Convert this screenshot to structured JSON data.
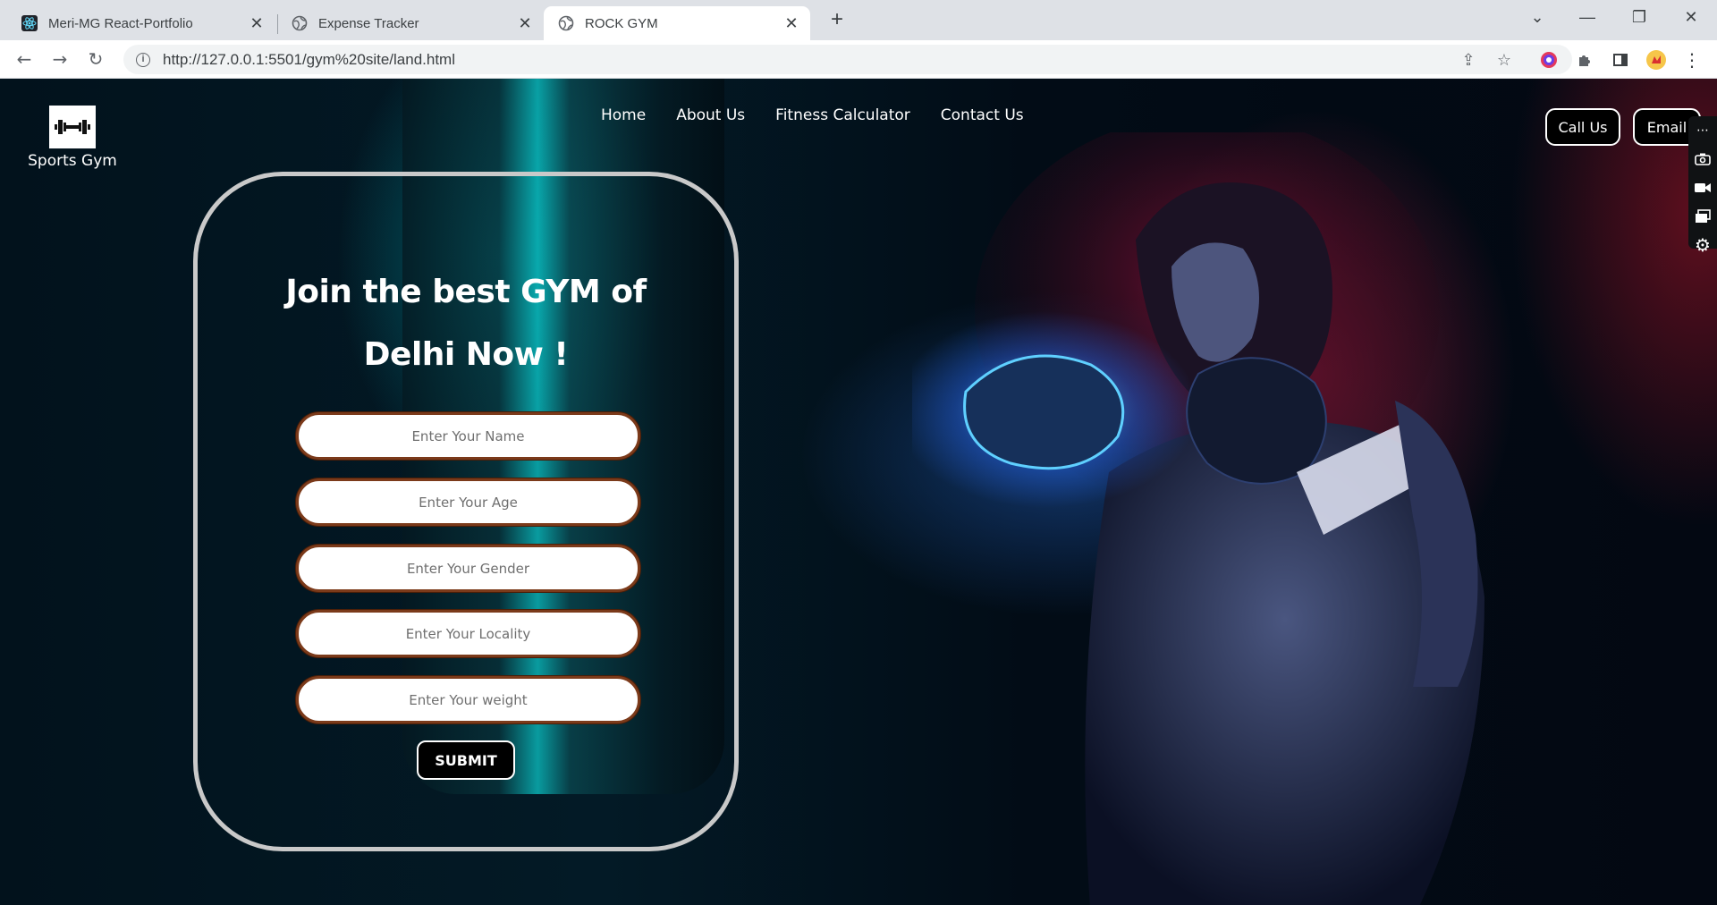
{
  "browser": {
    "tabs": [
      {
        "title": "Meri-MG React-Portfolio",
        "icon": "react-icon"
      },
      {
        "title": "Expense Tracker",
        "icon": "globe-icon"
      },
      {
        "title": "ROCK GYM",
        "icon": "globe-icon"
      }
    ],
    "url": "http://127.0.0.1:5501/gym%20site/land.html"
  },
  "site": {
    "brand": "Sports Gym",
    "nav": [
      "Home",
      "About Us",
      "Fitness Calculator",
      "Contact Us"
    ],
    "call_label": "Call Us",
    "email_label": "Email"
  },
  "form": {
    "headline_line1": "Join the best GYM of",
    "headline_line2": "Delhi Now !",
    "name_placeholder": "Enter Your Name",
    "age_placeholder": "Enter Your Age",
    "gender_placeholder": "Enter Your Gender",
    "locality_placeholder": "Enter Your Locality",
    "weight_placeholder": "Enter Your weight",
    "submit_label": "SUBMIT"
  },
  "colors": {
    "field_border": "#7b3a1a",
    "card_border": "#c9c9c9"
  }
}
